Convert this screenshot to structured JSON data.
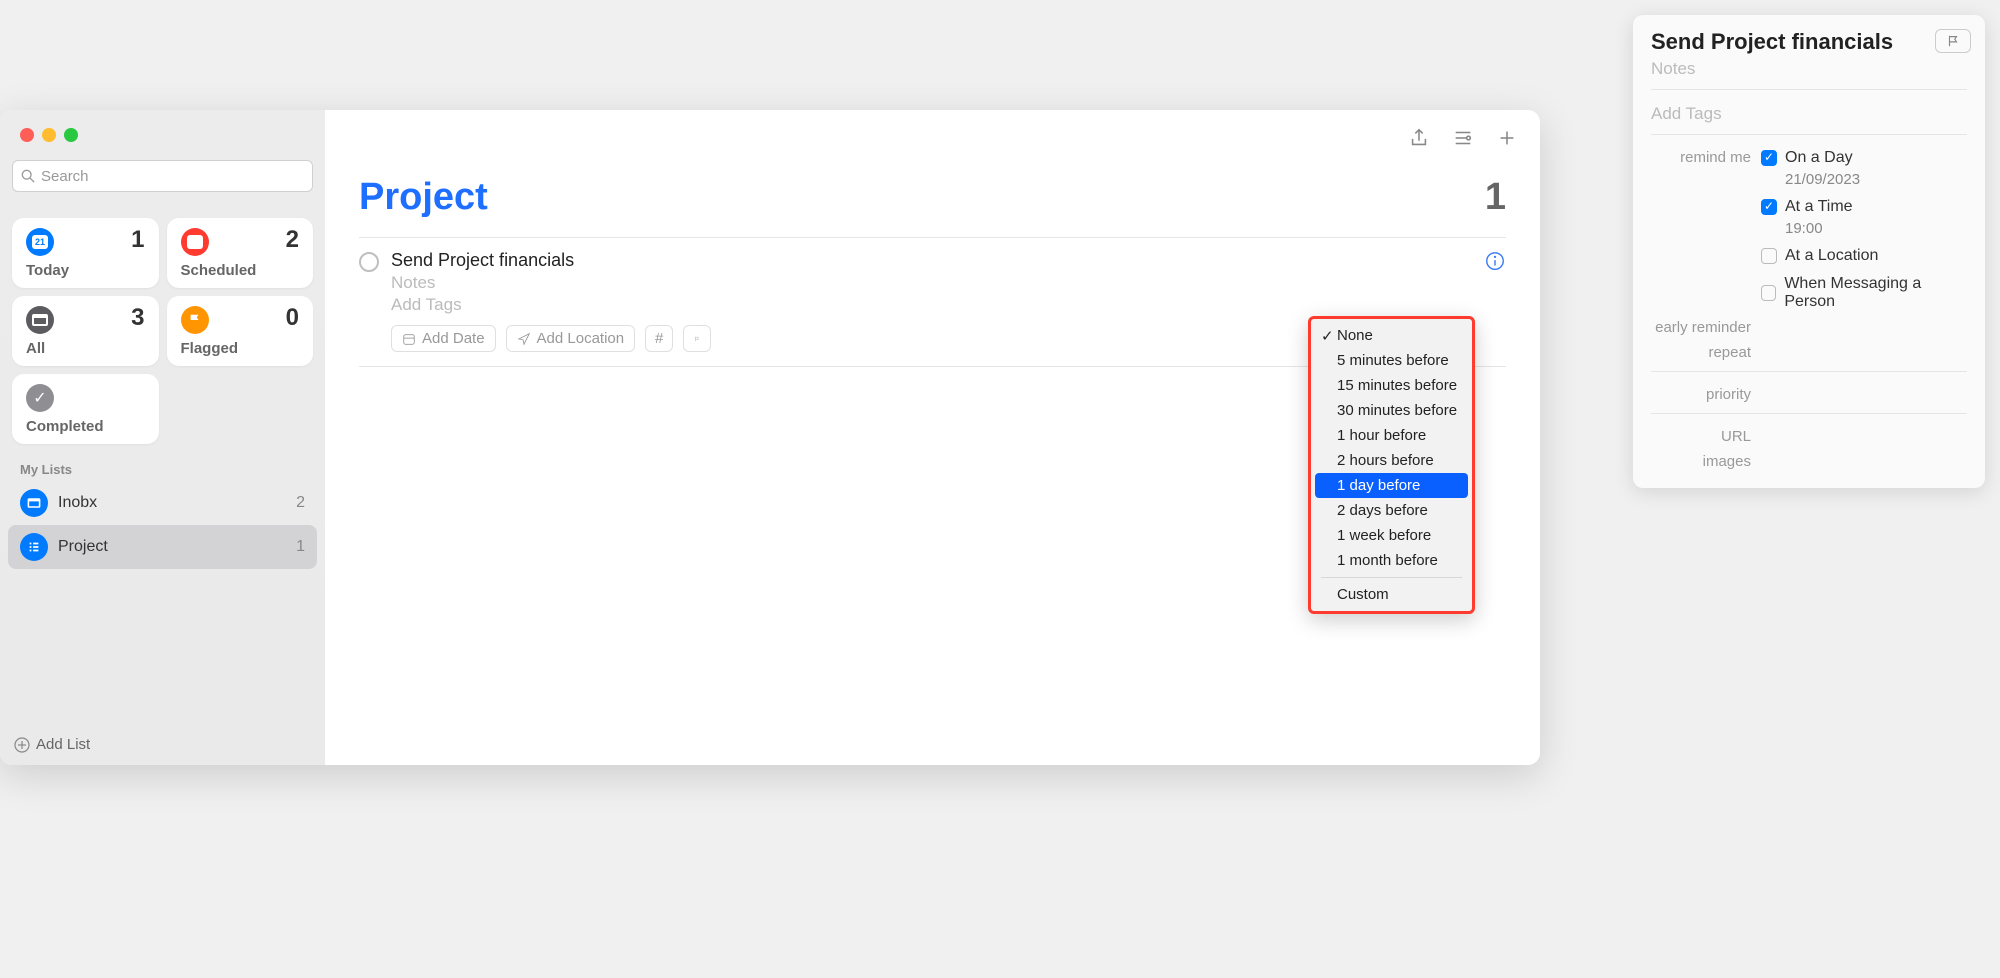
{
  "sidebar": {
    "search_placeholder": "Search",
    "smart": [
      {
        "label": "Today",
        "count": "1"
      },
      {
        "label": "Scheduled",
        "count": "2"
      },
      {
        "label": "All",
        "count": "3"
      },
      {
        "label": "Flagged",
        "count": "0"
      },
      {
        "label": "Completed",
        "count": ""
      }
    ],
    "section": "My Lists",
    "lists": [
      {
        "label": "Inobx",
        "count": "2"
      },
      {
        "label": "Project",
        "count": "1"
      }
    ],
    "add_list": "Add List"
  },
  "header": {
    "title": "Project",
    "count": "1"
  },
  "task": {
    "title": "Send Project financials",
    "notes": "Notes",
    "tags": "Add Tags",
    "add_date": "Add Date",
    "add_location": "Add Location",
    "hash": "#"
  },
  "details": {
    "title": "Send Project financials",
    "notes": "Notes",
    "tags": "Add Tags",
    "labels": {
      "remind": "remind me",
      "on_day": "On a Day",
      "date": "21/09/2023",
      "at_time": "At a Time",
      "time": "19:00",
      "at_loc": "At a Location",
      "when_msg": "When Messaging a Person",
      "early": "early reminder",
      "repeat": "repeat",
      "priority": "priority",
      "url": "URL",
      "images": "images"
    }
  },
  "dropdown": {
    "items": [
      "None",
      "5 minutes before",
      "15 minutes before",
      "30 minutes before",
      "1 hour before",
      "2 hours before",
      "1 day before",
      "2 days before",
      "1 week before",
      "1 month before"
    ],
    "custom": "Custom"
  }
}
